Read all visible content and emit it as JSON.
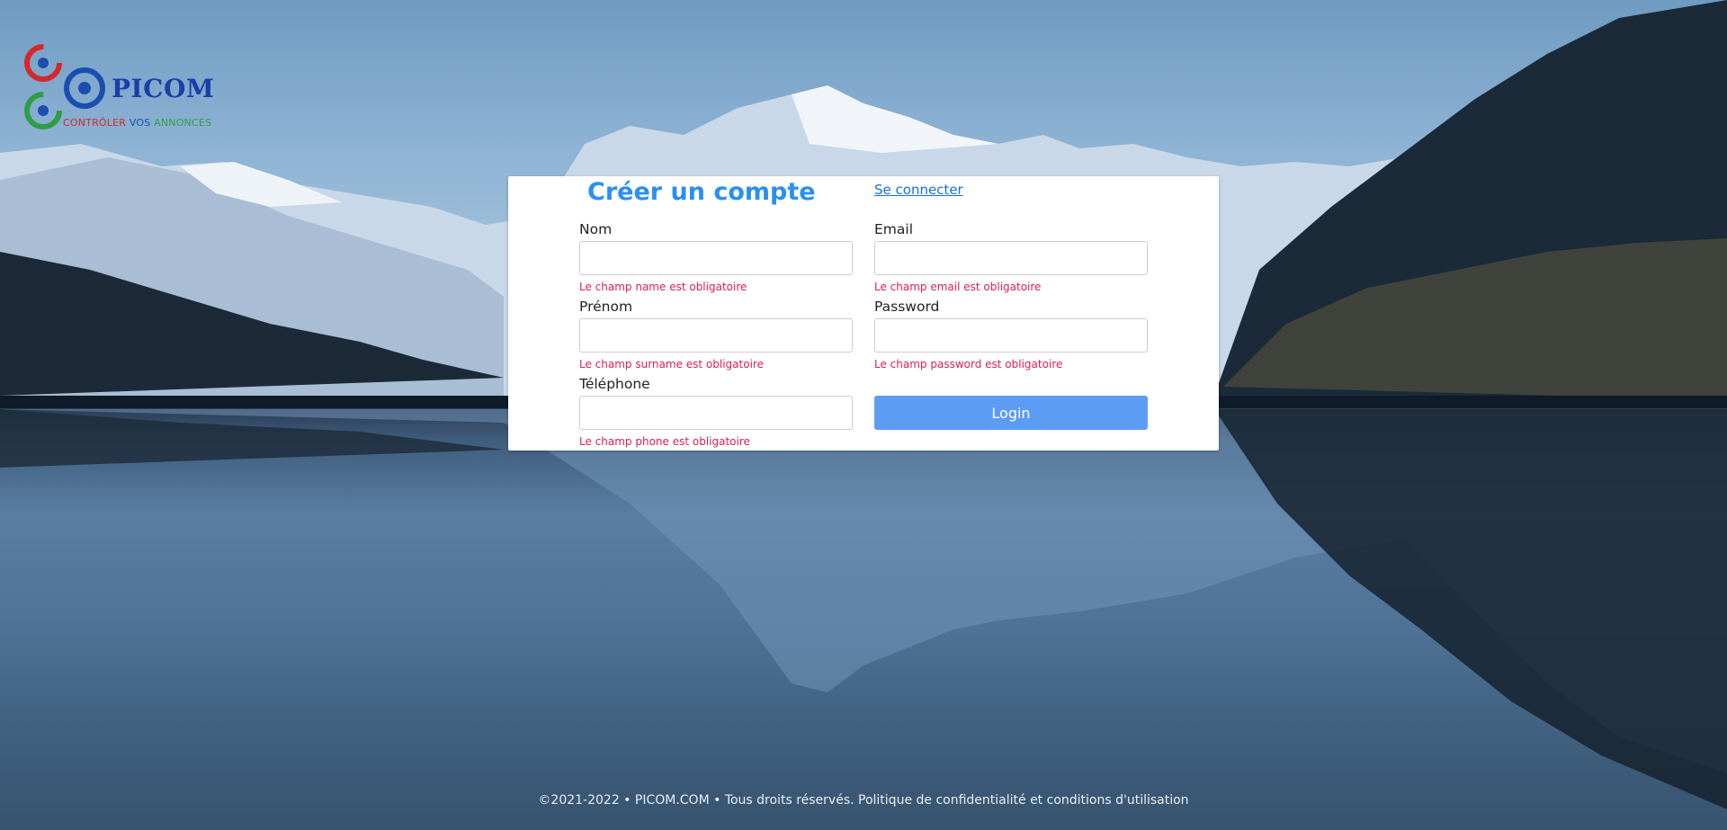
{
  "brand": {
    "name": "PICOM",
    "tagline": {
      "part1": "CONTRÔLER",
      "part2": "VOS",
      "part3": "ANNONCES"
    }
  },
  "form": {
    "title": "Créer un compte",
    "login_link": "Se connecter",
    "fields": {
      "nom": {
        "label": "Nom",
        "value": "",
        "error": "Le champ name est obligatoire"
      },
      "prenom": {
        "label": "Prénom",
        "value": "",
        "error": "Le champ surname est obligatoire"
      },
      "telephone": {
        "label": "Téléphone",
        "value": "",
        "error": "Le champ phone est obligatoire"
      },
      "email": {
        "label": "Email",
        "value": "",
        "error": "Le champ email est obligatoire"
      },
      "password": {
        "label": "Password",
        "value": "",
        "error": "Le champ password est obligatoire"
      }
    },
    "submit_label": "Login"
  },
  "footer": {
    "text": "©2021-2022 • PICOM.COM • Tous droits réservés. Politique de confidentialité et conditions d'utilisation"
  },
  "colors": {
    "title": "#2a8ff0",
    "error": "#dc1f4f",
    "button": "#5d9cf5",
    "logo_red": "#d62828",
    "logo_blue": "#1a4fb0",
    "logo_green": "#2e9e45"
  }
}
